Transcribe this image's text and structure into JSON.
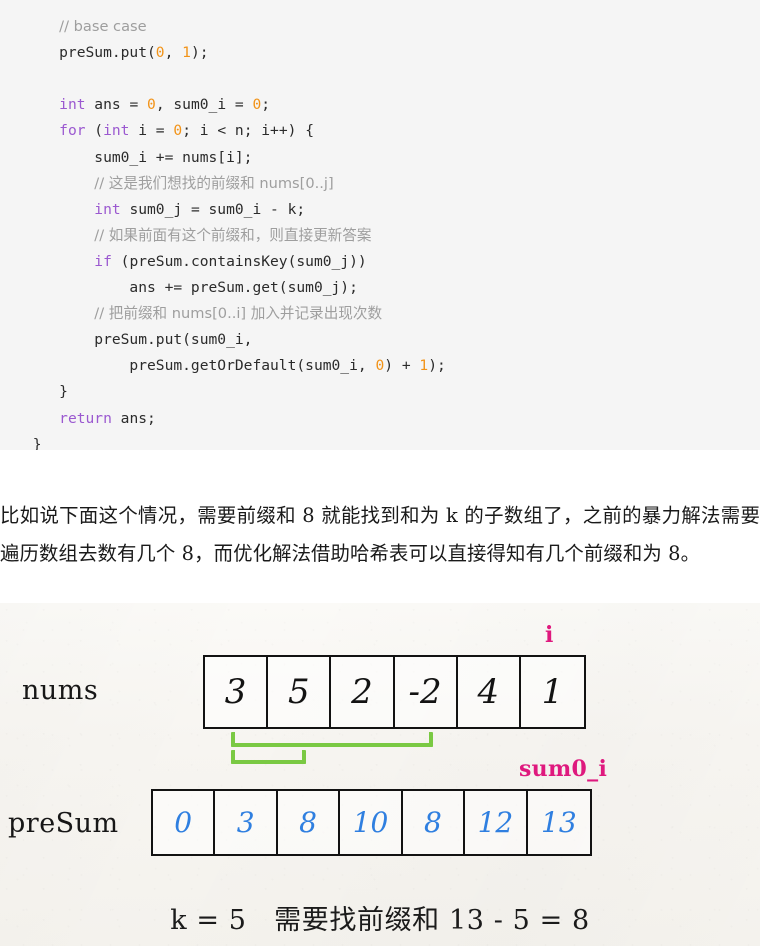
{
  "code_block": {
    "language": "java",
    "background": "#f5f5f5",
    "colors": {
      "keyword": "#9b59d0",
      "number": "#f29318",
      "comment": "#9e9e9e",
      "text": "#2b2b2b"
    },
    "lines": [
      {
        "id": "l0",
        "text": "    // base case",
        "clipped_top": true
      },
      {
        "id": "l1",
        "text": "    preSum.put(0, 1);"
      },
      {
        "id": "l2",
        "text": ""
      },
      {
        "id": "l3",
        "text": "    int ans = 0, sum0_i = 0;"
      },
      {
        "id": "l4",
        "text": "    for (int i = 0; i < n; i++) {"
      },
      {
        "id": "l5",
        "text": "        sum0_i += nums[i];"
      },
      {
        "id": "l6",
        "text": "        // 这是我们想找的前缀和 nums[0..j]"
      },
      {
        "id": "l7",
        "text": "        int sum0_j = sum0_i - k;"
      },
      {
        "id": "l8",
        "text": "        // 如果前面有这个前缀和，则直接更新答案"
      },
      {
        "id": "l9",
        "text": "        if (preSum.containsKey(sum0_j))"
      },
      {
        "id": "l10",
        "text": "            ans += preSum.get(sum0_j);"
      },
      {
        "id": "l11",
        "text": "        // 把前缀和 nums[0..i] 加入并记录出现次数"
      },
      {
        "id": "l12",
        "text": "        preSum.put(sum0_i,"
      },
      {
        "id": "l13",
        "text": "            preSum.getOrDefault(sum0_i, 0) + 1);"
      },
      {
        "id": "l14",
        "text": "    }"
      },
      {
        "id": "l15",
        "text": "    return ans;"
      },
      {
        "id": "l16",
        "text": "}"
      }
    ]
  },
  "paragraph": {
    "text": "比如说下面这个情况，需要前缀和 8 就能找到和为 k 的子数组了，之前的暴力解法需要遍历数组去数有几个 8，而优化解法借助哈希表可以直接得知有几个前缀和为 8。"
  },
  "diagram": {
    "nums_label": "nums",
    "presum_label": "preSum",
    "pointer_i_label": "i",
    "pointer_sum_label": "sum0_i",
    "nums_values": [
      "3",
      "5",
      "2",
      "-2",
      "4",
      "1"
    ],
    "presum_values": [
      "0",
      "3",
      "8",
      "10",
      "8",
      "12",
      "13"
    ],
    "bracket_upper": {
      "from_index": 0,
      "to_index": 3
    },
    "bracket_lower": {
      "from_index": 0,
      "to_index": 0
    },
    "colors": {
      "pointer": "#e1197f",
      "presum_ink": "#2f7fe0",
      "bracket": "#7ac943",
      "box_border": "#121212"
    },
    "caption": "k = 5　需要找前缀和 13 - 5 = 8"
  }
}
